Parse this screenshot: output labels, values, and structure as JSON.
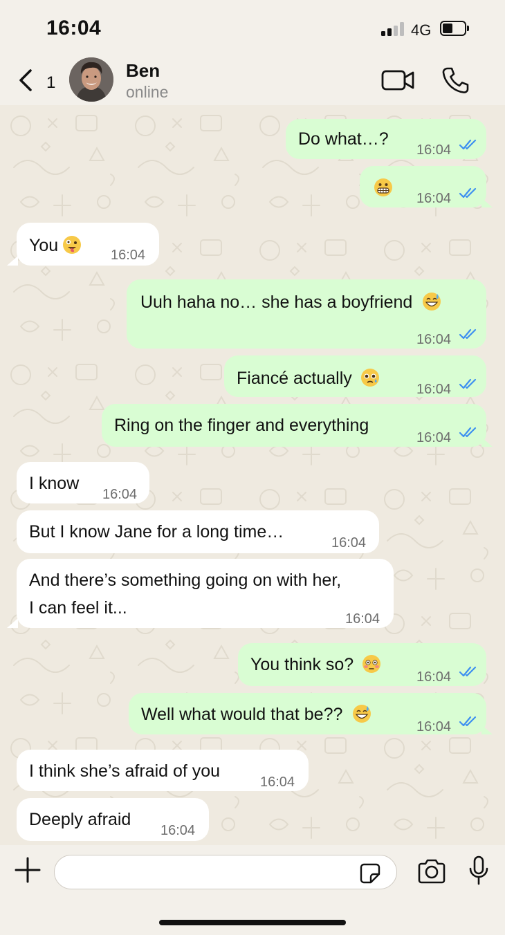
{
  "status_bar": {
    "time": "16:04",
    "network": "4G",
    "signal_bars": 2,
    "battery_level": 0.4
  },
  "header": {
    "back_count": "1",
    "contact_name": "Ben",
    "contact_status": "online",
    "back_icon": "chevron-left-icon",
    "video_icon": "video-camera-icon",
    "call_icon": "phone-icon"
  },
  "messages": [
    {
      "dir": "out",
      "text": "Do what…?",
      "emoji": "",
      "time": "16:04",
      "read": true
    },
    {
      "dir": "out",
      "text": "",
      "emoji": "grimacing-face",
      "time": "16:04",
      "read": true
    },
    {
      "dir": "in",
      "text": "You",
      "emoji": "zany-face",
      "time": "16:04"
    },
    {
      "dir": "out",
      "text": "Uuh haha no… she has a boyfriend",
      "emoji": "grinning-sweat-face",
      "time": "16:04",
      "read": true
    },
    {
      "dir": "out",
      "text": "Fiancé actually",
      "emoji": "pleading-face",
      "time": "16:04",
      "read": true
    },
    {
      "dir": "out",
      "text": "Ring on the finger and everything",
      "emoji": "",
      "time": "16:04",
      "read": true
    },
    {
      "dir": "in",
      "text": "I know",
      "emoji": "",
      "time": "16:04"
    },
    {
      "dir": "in",
      "text": "But I know Jane for a long time…",
      "emoji": "",
      "time": "16:04"
    },
    {
      "dir": "in",
      "text_lines": [
        "And there’s something going on with her,",
        "I can feel it..."
      ],
      "emoji": "",
      "time": "16:04"
    },
    {
      "dir": "out",
      "text": "You think so?",
      "emoji": "flushed-face",
      "time": "16:04",
      "read": true
    },
    {
      "dir": "out",
      "text": "Well what would that be??",
      "emoji": "grinning-sweat-face",
      "time": "16:04",
      "read": true
    },
    {
      "dir": "in",
      "text": "I think she’s afraid of you",
      "emoji": "",
      "time": "16:04"
    },
    {
      "dir": "in",
      "text": "Deeply afraid",
      "emoji": "",
      "time": "16:04"
    }
  ],
  "input_bar": {
    "placeholder": "",
    "add_icon": "plus-icon",
    "sticker_icon": "sticker-icon",
    "camera_icon": "camera-icon",
    "mic_icon": "microphone-icon"
  },
  "colors": {
    "outgoing_bubble": "#d9fdd3",
    "incoming_bubble": "#ffffff",
    "read_ticks": "#3d8ff0",
    "chat_background": "#efeae0"
  }
}
